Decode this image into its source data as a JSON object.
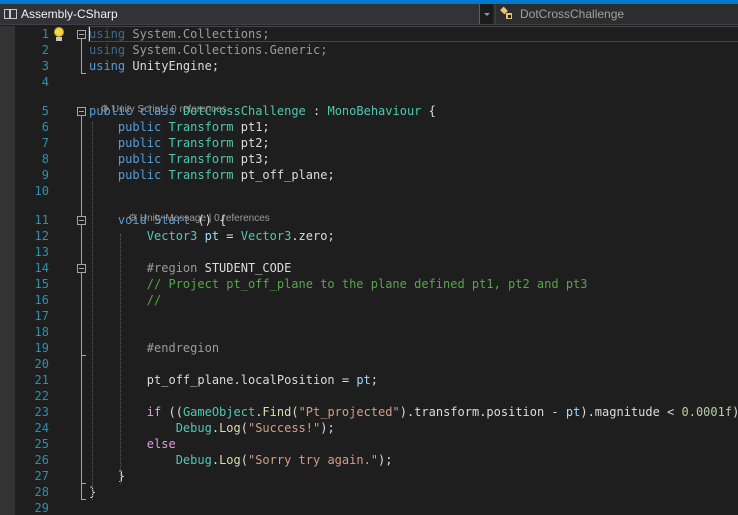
{
  "navbar": {
    "project_label": "Assembly-CSharp",
    "project_icon": "csharp-project-icon",
    "dropdown_icon": "chevron-down-icon",
    "type_label": "DotCrossChallenge",
    "type_icon": "class-icon"
  },
  "codelens": {
    "class": {
      "icon": "unity-icon",
      "kind": "Unity Script",
      "refs": "0 references"
    },
    "method": {
      "icon": "unity-icon",
      "kind": "Unity Message",
      "refs": "0 references"
    }
  },
  "colors": {
    "accent": "#007acc",
    "keyword": "#569cd6",
    "type": "#4ec9b0",
    "comment": "#57a64a",
    "string": "#d69d85",
    "line_number": "#2b91af",
    "background": "#1e1e1e"
  },
  "lines": [
    {
      "n": "1",
      "tokens": [
        [
          "kw-dim",
          "using"
        ],
        [
          "ty-dim",
          " System.Collections;"
        ]
      ]
    },
    {
      "n": "2",
      "tokens": [
        [
          "kw-dim",
          "using"
        ],
        [
          "ty-dim",
          " System.Collections.Generic;"
        ]
      ]
    },
    {
      "n": "3",
      "tokens": [
        [
          "kw",
          "using"
        ],
        [
          "id",
          " UnityEngine;"
        ]
      ]
    },
    {
      "n": "4",
      "tokens": []
    },
    {
      "n": "5",
      "tokens": [
        [
          "kw",
          "public"
        ],
        [
          "id",
          " "
        ],
        [
          "kw",
          "class"
        ],
        [
          "id",
          " "
        ],
        [
          "ty",
          "DotCrossChallenge"
        ],
        [
          "id",
          " : "
        ],
        [
          "ty",
          "MonoBehaviour"
        ],
        [
          "id",
          " {"
        ]
      ]
    },
    {
      "n": "6",
      "tokens": [
        [
          "id",
          "    "
        ],
        [
          "kw",
          "public"
        ],
        [
          "id",
          " "
        ],
        [
          "ty",
          "Transform"
        ],
        [
          "id",
          " pt1;"
        ]
      ]
    },
    {
      "n": "7",
      "tokens": [
        [
          "id",
          "    "
        ],
        [
          "kw",
          "public"
        ],
        [
          "id",
          " "
        ],
        [
          "ty",
          "Transform"
        ],
        [
          "id",
          " pt2;"
        ]
      ]
    },
    {
      "n": "8",
      "tokens": [
        [
          "id",
          "    "
        ],
        [
          "kw",
          "public"
        ],
        [
          "id",
          " "
        ],
        [
          "ty",
          "Transform"
        ],
        [
          "id",
          " pt3;"
        ]
      ]
    },
    {
      "n": "9",
      "tokens": [
        [
          "id",
          "    "
        ],
        [
          "kw",
          "public"
        ],
        [
          "id",
          " "
        ],
        [
          "ty",
          "Transform"
        ],
        [
          "id",
          " pt_off_plane;"
        ]
      ]
    },
    {
      "n": "10",
      "tokens": []
    },
    {
      "n": "11",
      "tokens": [
        [
          "id",
          "    "
        ],
        [
          "kw",
          "void"
        ],
        [
          "id",
          " "
        ],
        [
          "mt-blue",
          "Start"
        ],
        [
          "id",
          " () {"
        ]
      ]
    },
    {
      "n": "12",
      "tokens": [
        [
          "id",
          "        "
        ],
        [
          "ty",
          "Vector3"
        ],
        [
          "id",
          " "
        ],
        [
          "pm",
          "pt"
        ],
        [
          "id",
          " = "
        ],
        [
          "ty",
          "Vector3"
        ],
        [
          "id",
          ".zero;"
        ]
      ]
    },
    {
      "n": "13",
      "tokens": []
    },
    {
      "n": "14",
      "tokens": [
        [
          "id",
          "        "
        ],
        [
          "pp",
          "#region"
        ],
        [
          "id",
          " STUDENT_CODE"
        ]
      ]
    },
    {
      "n": "15",
      "tokens": [
        [
          "id",
          "        "
        ],
        [
          "cm",
          "// Project pt_off_plane to the plane defined pt1, pt2 and pt3"
        ]
      ]
    },
    {
      "n": "16",
      "tokens": [
        [
          "id",
          "        "
        ],
        [
          "cm",
          "//"
        ]
      ]
    },
    {
      "n": "17",
      "tokens": []
    },
    {
      "n": "18",
      "tokens": []
    },
    {
      "n": "19",
      "tokens": [
        [
          "id",
          "        "
        ],
        [
          "pp",
          "#endregion"
        ]
      ]
    },
    {
      "n": "20",
      "tokens": []
    },
    {
      "n": "21",
      "tokens": [
        [
          "id",
          "        pt_off_plane.localPosition = "
        ],
        [
          "pm",
          "pt"
        ],
        [
          "id",
          ";"
        ]
      ]
    },
    {
      "n": "22",
      "tokens": []
    },
    {
      "n": "23",
      "tokens": [
        [
          "id",
          "        "
        ],
        [
          "ctl",
          "if"
        ],
        [
          "id",
          " (("
        ],
        [
          "ty",
          "GameObject"
        ],
        [
          "id",
          "."
        ],
        [
          "mt",
          "Find"
        ],
        [
          "id",
          "("
        ],
        [
          "st",
          "\"Pt_projected\""
        ],
        [
          "id",
          ").transform.position - "
        ],
        [
          "pm",
          "pt"
        ],
        [
          "id",
          ").magnitude < "
        ],
        [
          "nm",
          "0.0001f"
        ],
        [
          "id",
          ")"
        ]
      ]
    },
    {
      "n": "24",
      "tokens": [
        [
          "id",
          "            "
        ],
        [
          "ty",
          "Debug"
        ],
        [
          "id",
          "."
        ],
        [
          "mt",
          "Log"
        ],
        [
          "id",
          "("
        ],
        [
          "st",
          "\"Success!\""
        ],
        [
          "id",
          ");"
        ]
      ]
    },
    {
      "n": "25",
      "tokens": [
        [
          "id",
          "        "
        ],
        [
          "ctl",
          "else"
        ]
      ]
    },
    {
      "n": "26",
      "tokens": [
        [
          "id",
          "            "
        ],
        [
          "ty",
          "Debug"
        ],
        [
          "id",
          "."
        ],
        [
          "mt",
          "Log"
        ],
        [
          "id",
          "("
        ],
        [
          "st",
          "\"Sorry try again.\""
        ],
        [
          "id",
          ");"
        ]
      ]
    },
    {
      "n": "27",
      "tokens": [
        [
          "id",
          "    }"
        ]
      ]
    },
    {
      "n": "28",
      "tokens": [
        [
          "id",
          "}"
        ]
      ]
    },
    {
      "n": "29",
      "tokens": []
    }
  ]
}
